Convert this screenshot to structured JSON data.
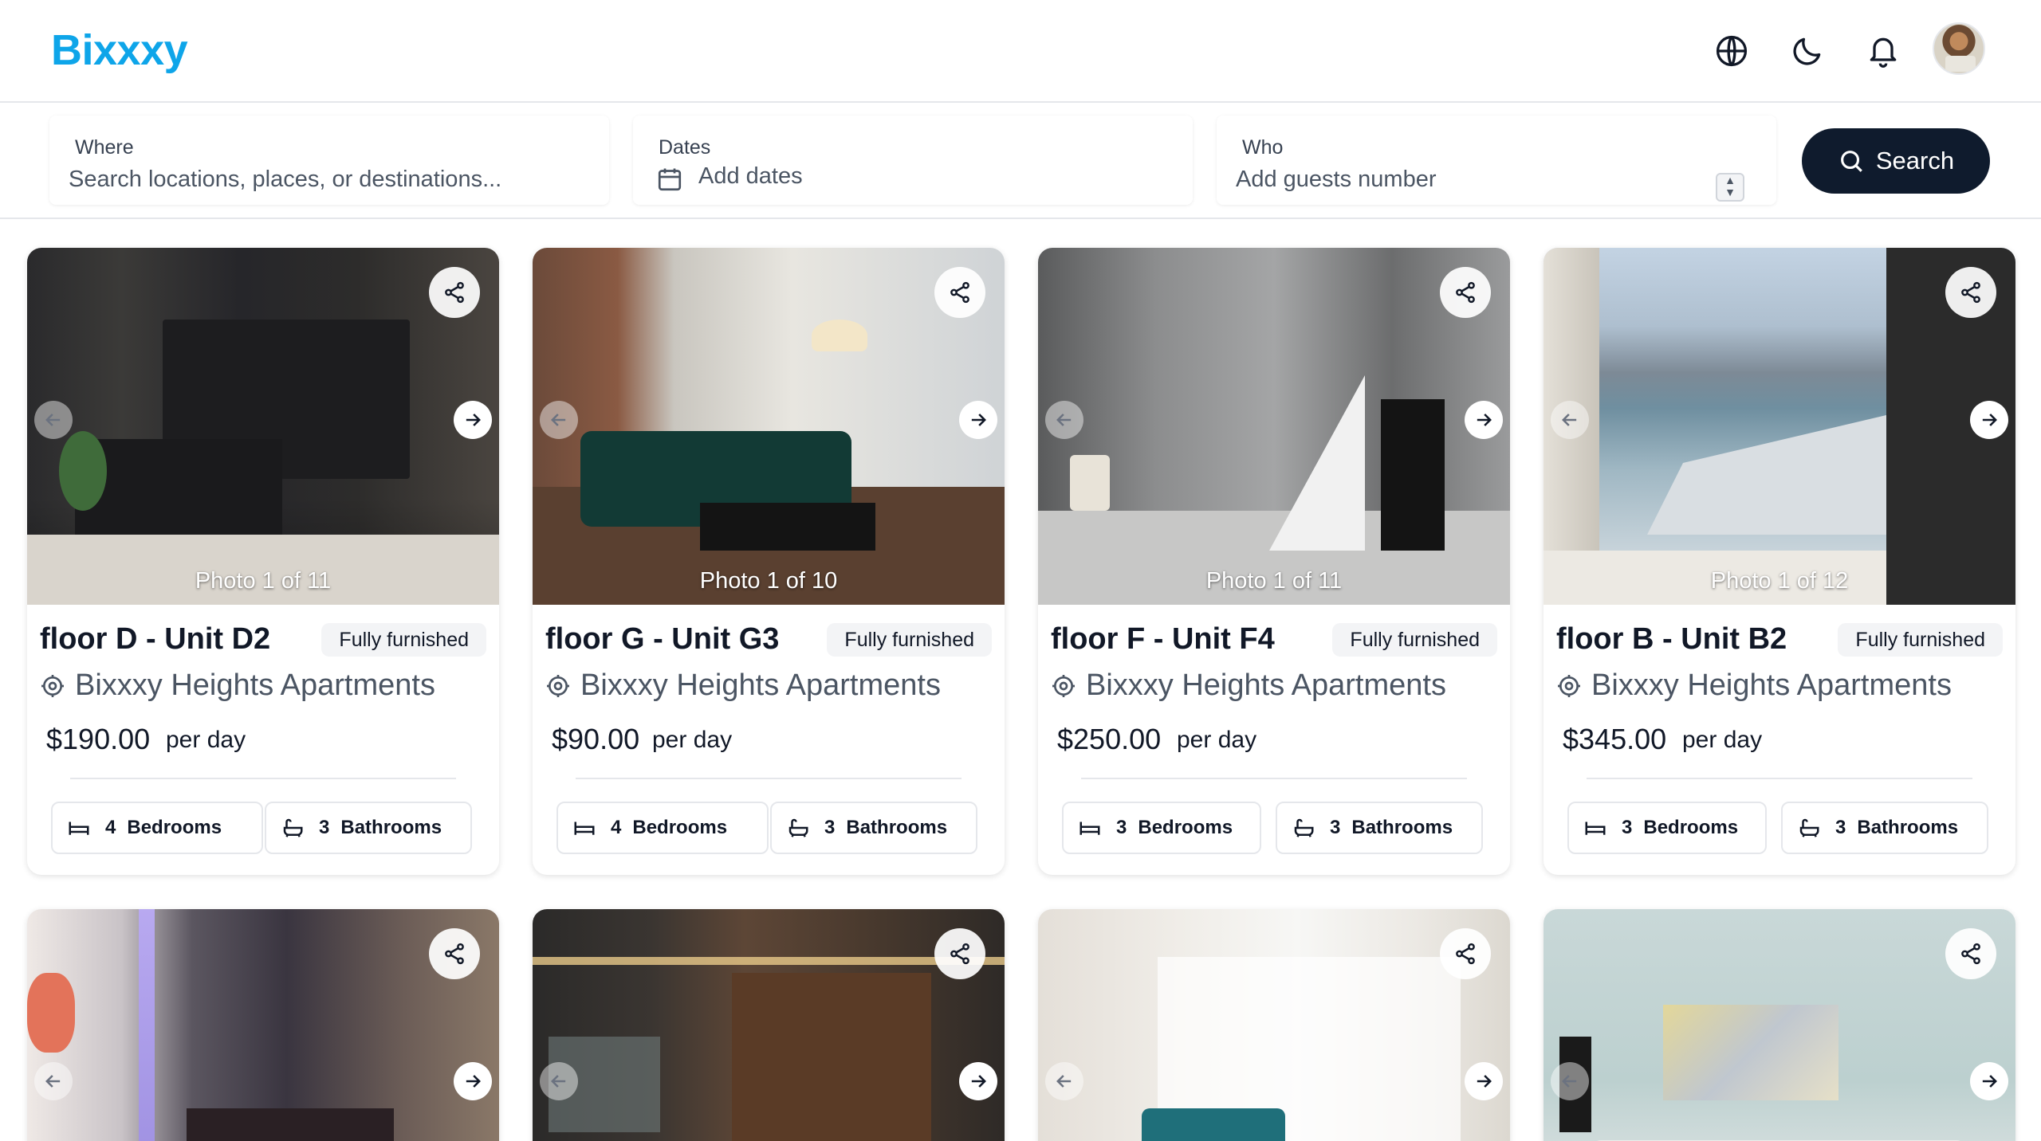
{
  "app": {
    "logo": "Bixxxy"
  },
  "header": {
    "icons": [
      "globe-icon",
      "moon-icon",
      "bell-icon"
    ],
    "avatar_alt": "user-avatar"
  },
  "search": {
    "where": {
      "label": "Where",
      "placeholder": "Search locations, places, or destinations..."
    },
    "dates": {
      "label": "Dates",
      "placeholder": "Add dates"
    },
    "who": {
      "label": "Who",
      "placeholder": "Add guests number"
    },
    "button_label": "Search"
  },
  "colors": {
    "accent": "#0ea5e9",
    "button": "#0f1b2d",
    "badge_bg": "#f3f4f6"
  },
  "listings": [
    {
      "title": "floor D - Unit D2",
      "badge": "Fully furnished",
      "building": "Bixxxy Heights Apartments",
      "price": "$190.00",
      "per": "per day",
      "photo_counter": "Photo 1 of 11",
      "bedrooms": "4",
      "bedrooms_label": "Bedrooms",
      "bathrooms": "3",
      "bathrooms_label": "Bathrooms"
    },
    {
      "title": "floor G - Unit G3",
      "badge": "Fully furnished",
      "building": "Bixxxy Heights Apartments",
      "price": "$90.00",
      "per": "per day",
      "photo_counter": "Photo 1 of 10",
      "bedrooms": "4",
      "bedrooms_label": "Bedrooms",
      "bathrooms": "3",
      "bathrooms_label": "Bathrooms"
    },
    {
      "title": "floor F - Unit F4",
      "badge": "Fully furnished",
      "building": "Bixxxy Heights Apartments",
      "price": "$250.00",
      "per": "per day",
      "photo_counter": "Photo 1 of 11",
      "bedrooms": "3",
      "bedrooms_label": "Bedrooms",
      "bathrooms": "3",
      "bathrooms_label": "Bathrooms"
    },
    {
      "title": "floor B - Unit B2",
      "badge": "Fully furnished",
      "building": "Bixxxy Heights Apartments",
      "price": "$345.00",
      "per": "per day",
      "photo_counter": "Photo 1 of 12",
      "bedrooms": "3",
      "bedrooms_label": "Bedrooms",
      "bathrooms": "3",
      "bathrooms_label": "Bathrooms"
    }
  ]
}
